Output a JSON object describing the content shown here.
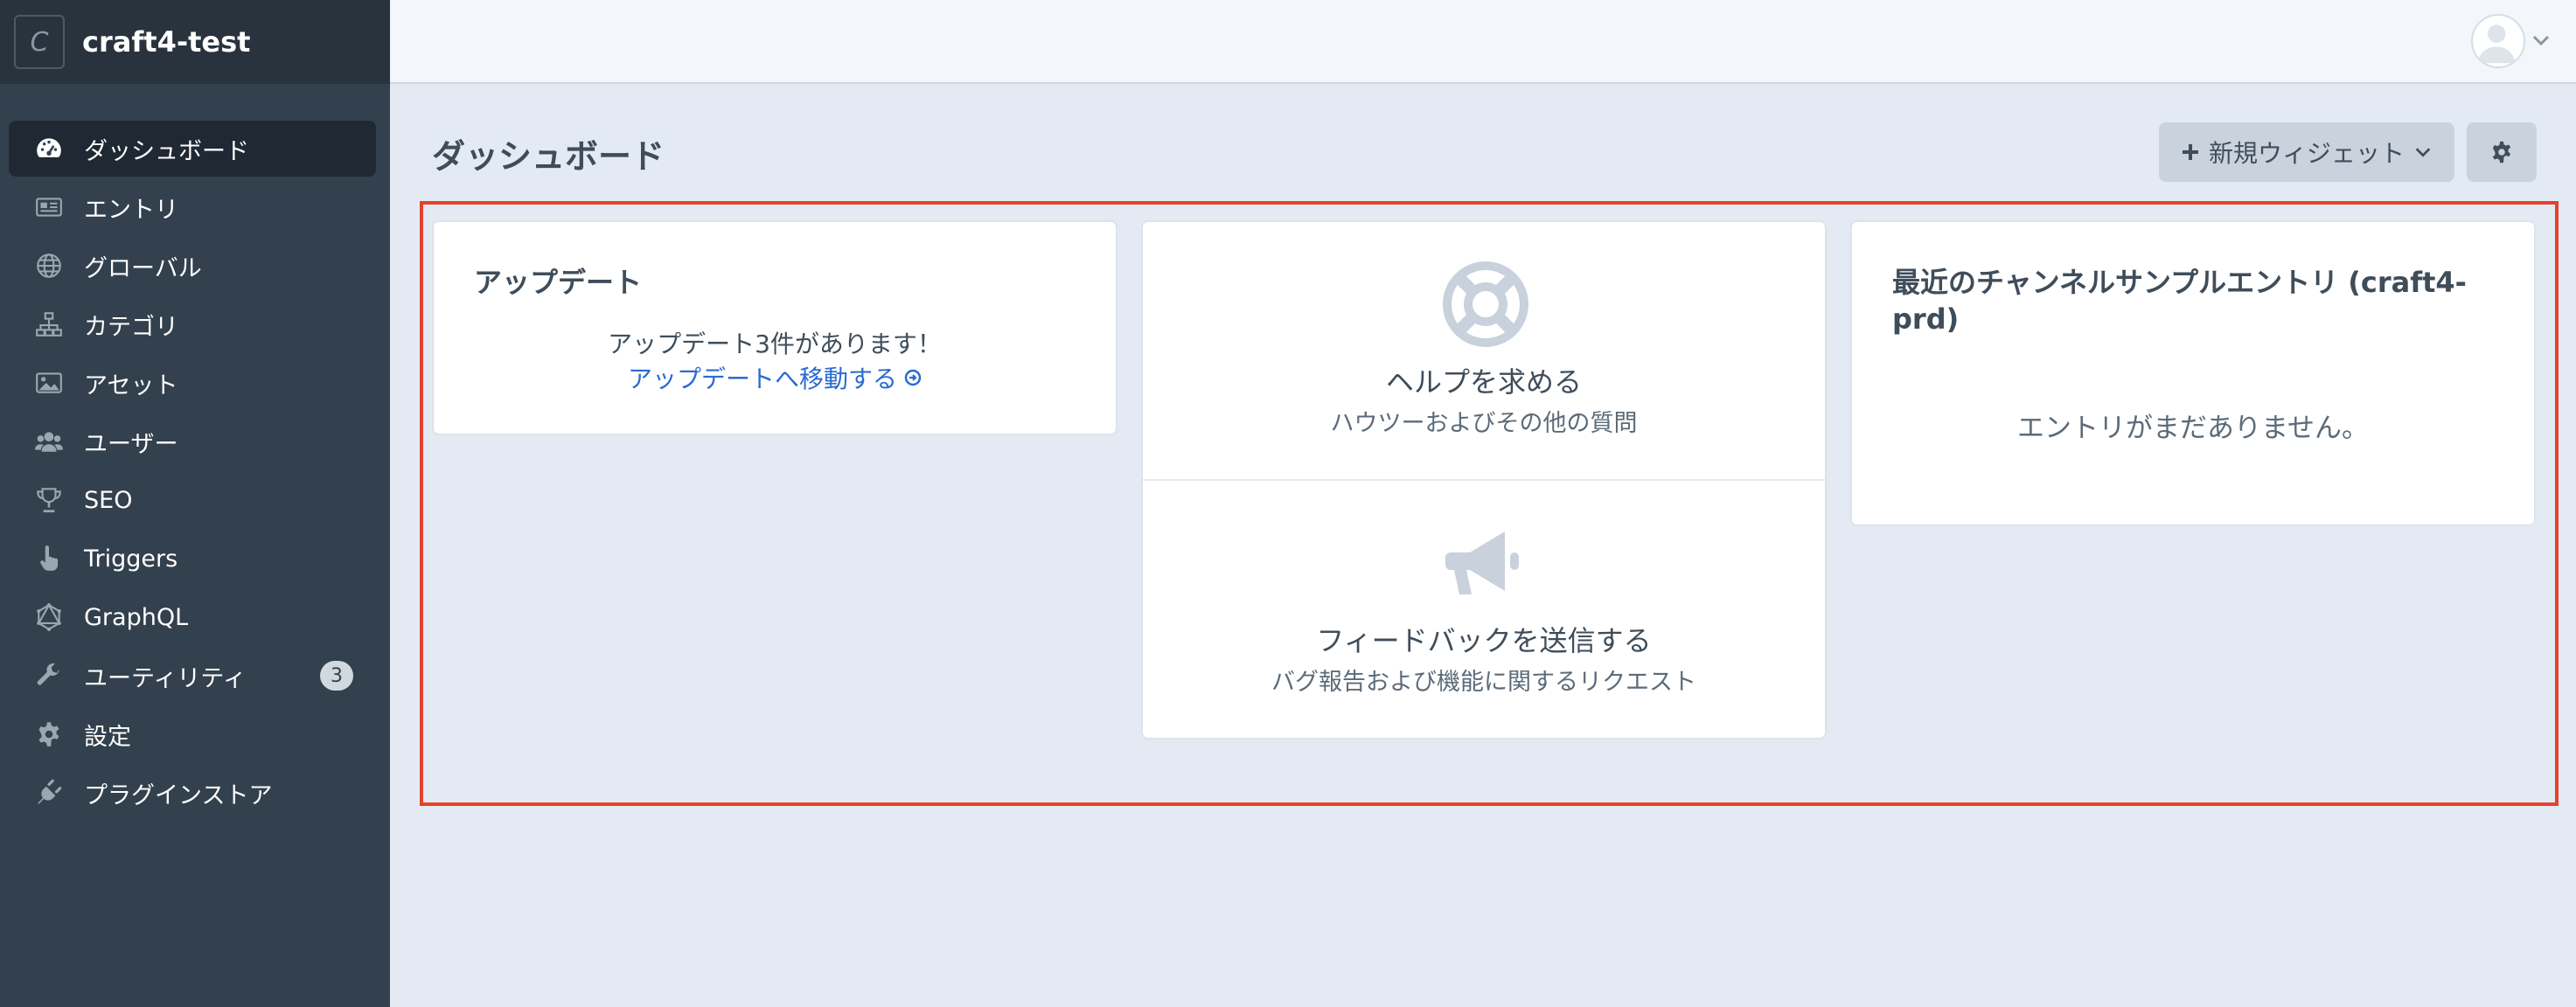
{
  "site": {
    "initial": "C",
    "name": "craft4-test"
  },
  "sidebar": {
    "items": [
      {
        "label": "ダッシュボード",
        "icon": "gauge-icon",
        "active": true
      },
      {
        "label": "エントリ",
        "icon": "newspaper-icon"
      },
      {
        "label": "グローバル",
        "icon": "globe-icon"
      },
      {
        "label": "カテゴリ",
        "icon": "sitemap-icon"
      },
      {
        "label": "アセット",
        "icon": "image-icon"
      },
      {
        "label": "ユーザー",
        "icon": "users-icon"
      },
      {
        "label": "SEO",
        "icon": "trophy-icon"
      },
      {
        "label": "Triggers",
        "icon": "hand-pointer-icon"
      },
      {
        "label": "GraphQL",
        "icon": "graphql-icon"
      },
      {
        "label": "ユーティリティ",
        "icon": "wrench-icon",
        "badge": "3"
      },
      {
        "label": "設定",
        "icon": "gear-icon"
      },
      {
        "label": "プラグインストア",
        "icon": "plug-icon"
      }
    ]
  },
  "page": {
    "title": "ダッシュボード",
    "new_widget_label": "新規ウィジェット"
  },
  "widgets": {
    "updates": {
      "title": "アップデート",
      "message": "アップデート3件があります！",
      "link": "アップデートへ移動する"
    },
    "help": {
      "help_title": "ヘルプを求める",
      "help_sub": "ハウツーおよびその他の質問",
      "feedback_title": "フィードバックを送信する",
      "feedback_sub": "バグ報告および機能に関するリクエスト"
    },
    "recent": {
      "title": "最近のチャンネルサンプルエントリ (craft4-prd)",
      "empty": "エントリがまだありません。"
    }
  },
  "colors": {
    "sidebar": "#33404d",
    "sidebar_header": "#29333d",
    "active_item": "#1f2833",
    "page_bg": "#e4eaf3",
    "link": "#2a6bd1",
    "highlight": "#e5412c"
  }
}
